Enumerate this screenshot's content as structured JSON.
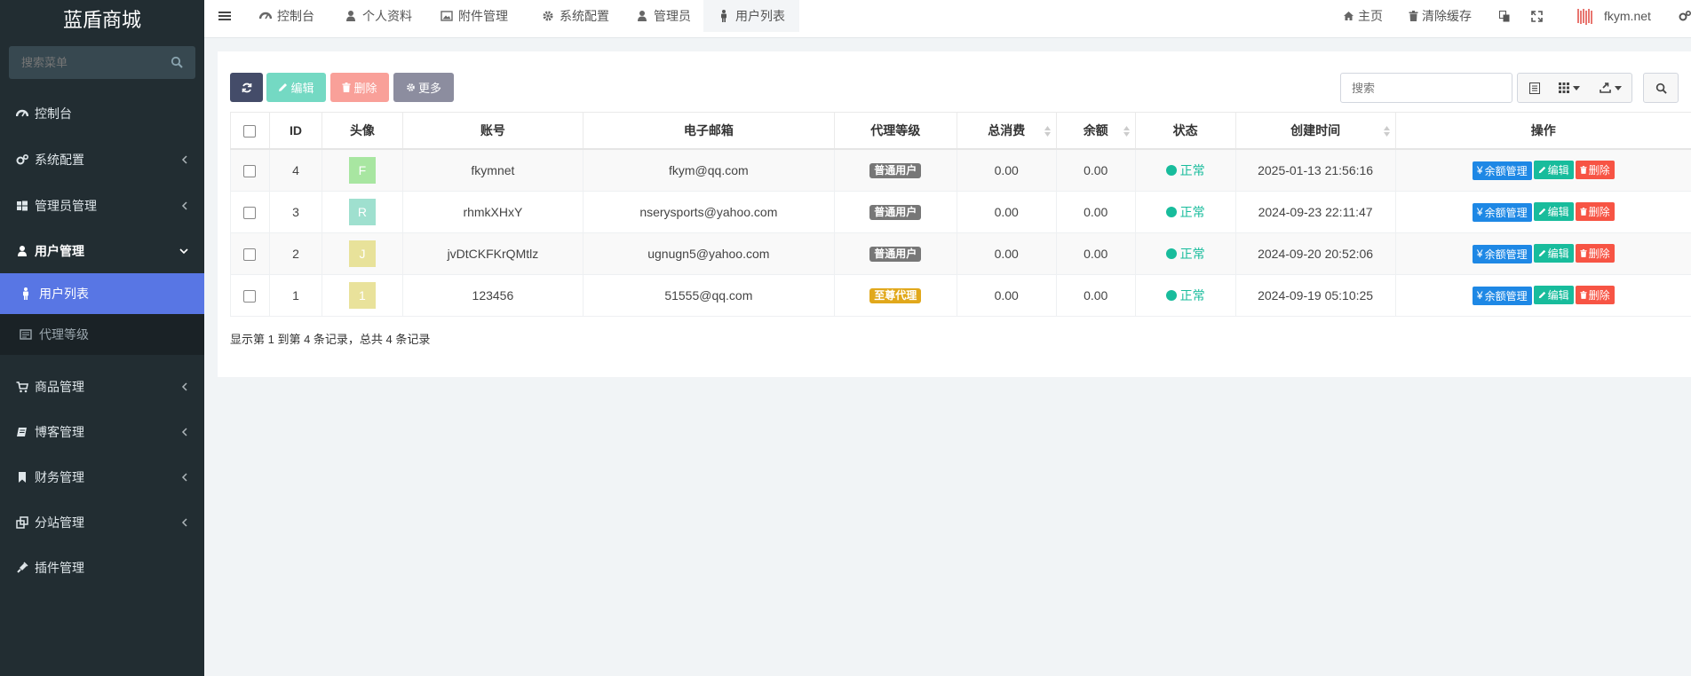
{
  "app": {
    "title": "蓝盾商城"
  },
  "sidebar": {
    "search_placeholder": "搜索菜单",
    "items": [
      {
        "label": "控制台",
        "icon": "dashboard-icon"
      },
      {
        "label": "系统配置",
        "icon": "cogs-icon"
      },
      {
        "label": "管理员管理",
        "icon": "windows-icon"
      },
      {
        "label": "用户管理",
        "icon": "user-icon"
      },
      {
        "label": "用户列表",
        "icon": "male-icon"
      },
      {
        "label": "代理等级",
        "icon": "list-alt-icon"
      },
      {
        "label": "商品管理",
        "icon": "cart-icon"
      },
      {
        "label": "博客管理",
        "icon": "book-icon"
      },
      {
        "label": "财务管理",
        "icon": "bookmark-icon"
      },
      {
        "label": "分站管理",
        "icon": "clone-icon"
      },
      {
        "label": "插件管理",
        "icon": "plug-icon"
      }
    ]
  },
  "topbar": {
    "tabs": [
      {
        "label": "控制台"
      },
      {
        "label": "个人资料"
      },
      {
        "label": "附件管理"
      },
      {
        "label": "系统配置"
      },
      {
        "label": "管理员"
      },
      {
        "label": "用户列表"
      }
    ],
    "home": "主页",
    "clear_cache": "清除缓存",
    "username": "fkym.net"
  },
  "toolbar": {
    "edit": "编辑",
    "delete": "删除",
    "more": "更多",
    "search_placeholder": "搜索"
  },
  "table": {
    "headers": [
      "ID",
      "头像",
      "账号",
      "电子邮箱",
      "代理等级",
      "总消费",
      "余额",
      "状态",
      "创建时间",
      "操作"
    ],
    "rows": [
      {
        "id": "4",
        "avatar": "F",
        "avatar_color": "#a8e6a1",
        "account": "fkymnet",
        "email": "fkym@qq.com",
        "level": "普通用户",
        "level_color": "#777777",
        "spent": "0.00",
        "balance": "0.00",
        "status": "正常",
        "created": "2025-01-13 21:56:16"
      },
      {
        "id": "3",
        "avatar": "R",
        "avatar_color": "#9fe0cf",
        "account": "rhmkXHxY",
        "email": "nserysports@yahoo.com",
        "level": "普通用户",
        "level_color": "#777777",
        "spent": "0.00",
        "balance": "0.00",
        "status": "正常",
        "created": "2024-09-23 22:11:47"
      },
      {
        "id": "2",
        "avatar": "J",
        "avatar_color": "#e8e29a",
        "account": "jvDtCKFKrQMtlz",
        "email": "ugnugn5@yahoo.com",
        "level": "普通用户",
        "level_color": "#777777",
        "spent": "0.00",
        "balance": "0.00",
        "status": "正常",
        "created": "2024-09-20 20:52:06"
      },
      {
        "id": "1",
        "avatar": "1",
        "avatar_color": "#e9e29b",
        "account": "123456",
        "email": "51555@qq.com",
        "level": "至尊代理",
        "level_color": "#e1a81b",
        "spent": "0.00",
        "balance": "0.00",
        "status": "正常",
        "created": "2024-09-19 05:10:25"
      }
    ],
    "actions": {
      "balance": "余额管理",
      "edit": "编辑",
      "delete": "删除"
    }
  },
  "pagination": {
    "summary": "显示第 1 到第 4 条记录，总共 4 条记录"
  },
  "colors": {
    "sidebar_bg": "#222d32",
    "active_menu": "#5876e4",
    "success": "#18bc9c",
    "danger": "#f75444",
    "primary": "#1e88e5"
  }
}
